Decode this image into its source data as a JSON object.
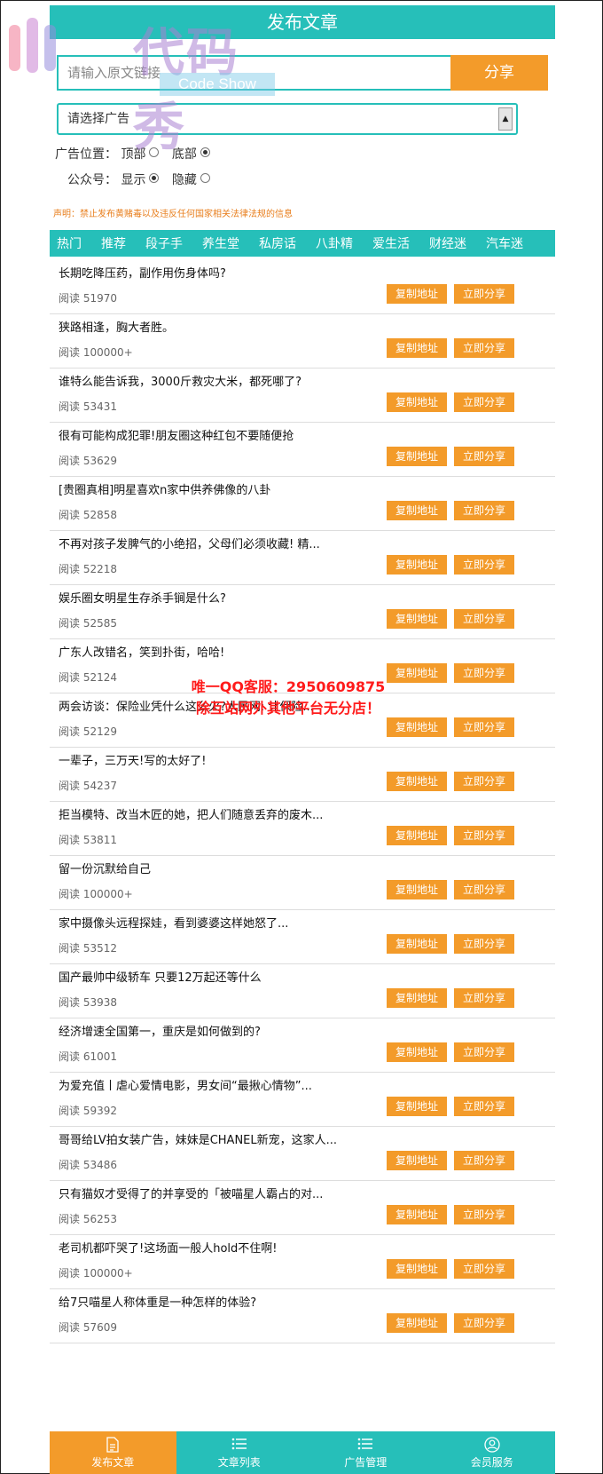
{
  "header": {
    "title": "发布文章"
  },
  "watermark": {
    "title": "代码秀",
    "subtitle": "Code Show"
  },
  "share": {
    "placeholder": "请输入原文链接",
    "button": "分享"
  },
  "ad_select": {
    "value": "请选择广告"
  },
  "ad_position": {
    "label": "广告位置：",
    "options": [
      "顶部",
      "底部"
    ],
    "selected": 1
  },
  "account": {
    "label": "公众号：",
    "options": [
      "显示",
      "隐藏"
    ],
    "selected": 0
  },
  "notice": "声明：禁止发布黄赌毒以及违反任何国家相关法律法规的信息",
  "tabs": [
    "热门",
    "推荐",
    "段子手",
    "养生堂",
    "私房话",
    "八卦精",
    "爱生活",
    "财经迷",
    "汽车迷"
  ],
  "buttons": {
    "copy": "复制地址",
    "share": "立即分享"
  },
  "articles": [
    {
      "title": "长期吃降压药，副作用伤身体吗?",
      "reads": "阅读 51970"
    },
    {
      "title": "狭路相逢，胸大者胜。",
      "reads": "阅读 100000+"
    },
    {
      "title": "谁特么能告诉我，3000斤救灾大米，都死哪了?",
      "reads": "阅读 53431"
    },
    {
      "title": "很有可能构成犯罪!朋友圈这种红包不要随便抢",
      "reads": "阅读 53629"
    },
    {
      "title": "[贵圈真相]明星喜欢n家中供养佛像的八卦",
      "reads": "阅读 52858"
    },
    {
      "title": "不再对孩子发脾气的小绝招，父母们必须收藏! 精...",
      "reads": "阅读 52218"
    },
    {
      "title": "娱乐圈女明星生存杀手锏是什么?",
      "reads": "阅读 52585"
    },
    {
      "title": "广东人改错名，笑到扑街，哈哈!",
      "reads": "阅读 52124"
    },
    {
      "title": "两会访谈：保险业凭什么这么火?人民网: 让保险...",
      "reads": "阅读 52129"
    },
    {
      "title": "一辈子，三万天!写的太好了!",
      "reads": "阅读 54237"
    },
    {
      "title": "拒当模特、改当木匠的她，把人们随意丢弃的废木...",
      "reads": "阅读 53811"
    },
    {
      "title": "留一份沉默给自己",
      "reads": "阅读 100000+"
    },
    {
      "title": "家中摄像头远程探娃，看到婆婆这样她怒了...",
      "reads": "阅读 53512"
    },
    {
      "title": "国产最帅中级轿车 只要12万起还等什么",
      "reads": "阅读 53938"
    },
    {
      "title": "经济增速全国第一，重庆是如何做到的?",
      "reads": "阅读 61001"
    },
    {
      "title": "为爱充值丨虐心爱情电影，男女间“最揪心情物”...",
      "reads": "阅读 59392"
    },
    {
      "title": "哥哥给LV拍女装广告，妹妹是CHANEL新宠，这家人...",
      "reads": "阅读 53486"
    },
    {
      "title": "只有猫奴才受得了的并享受的「被喵星人霸占的对...",
      "reads": "阅读 56253"
    },
    {
      "title": "老司机都吓哭了!这场面一般人hold不住啊!",
      "reads": "阅读 100000+"
    },
    {
      "title": "给7只喵星人称体重是一种怎样的体验?",
      "reads": "阅读 57609"
    }
  ],
  "overlay": {
    "line1": "唯一QQ客服：2950609875",
    "line2": "除互站网外其他平台无分店！"
  },
  "bottom_nav": [
    {
      "label": "发布文章",
      "icon": "document-icon",
      "active": true
    },
    {
      "label": "文章列表",
      "icon": "list-icon",
      "active": false
    },
    {
      "label": "广告管理",
      "icon": "list-icon",
      "active": false
    },
    {
      "label": "会员服务",
      "icon": "user-icon",
      "active": false
    }
  ],
  "colors": {
    "teal": "#26bfb9",
    "orange": "#f39b2a",
    "overlay_red": "#ff1b1b"
  }
}
